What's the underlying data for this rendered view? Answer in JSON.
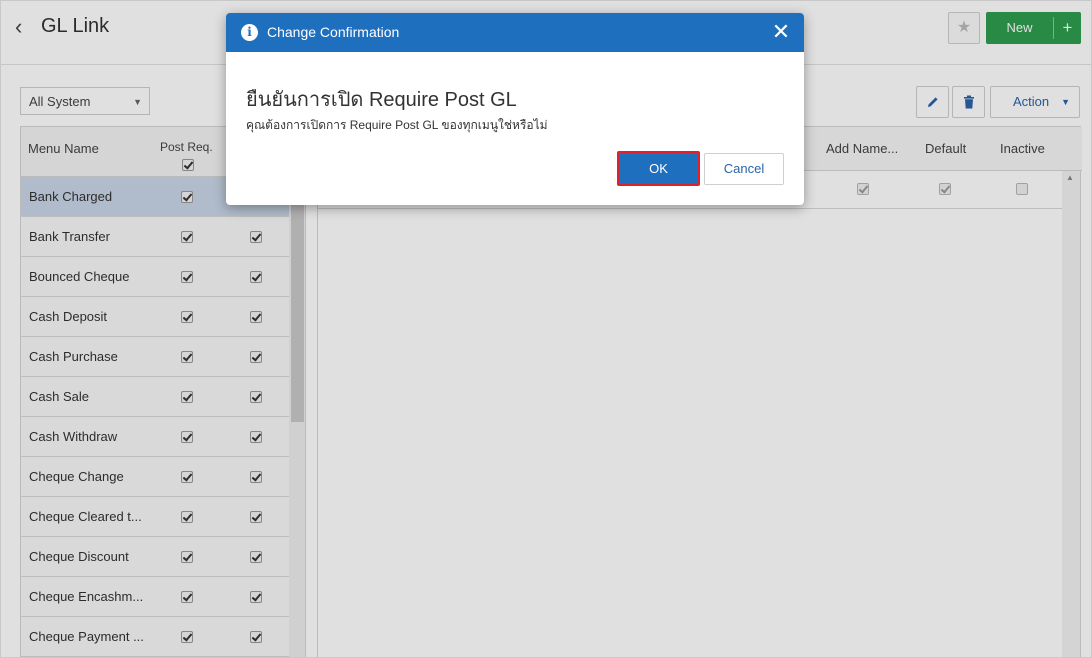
{
  "header": {
    "back_icon": "chevron-left-icon",
    "title": "GL Link",
    "favorite_icon": "star-icon",
    "new_label": "New",
    "new_plus": "+"
  },
  "toolbar": {
    "system_select": "All System",
    "edit_icon": "pencil-icon",
    "delete_icon": "trash-icon",
    "action_label": "Action"
  },
  "left_table": {
    "col_menu_name": "Menu Name",
    "col_post_req": "Post Req.",
    "header_post_req_checked": true,
    "rows": [
      {
        "name": "Bank Charged",
        "c1": true,
        "c2": true,
        "selected": true
      },
      {
        "name": "Bank Transfer",
        "c1": true,
        "c2": true
      },
      {
        "name": "Bounced Cheque",
        "c1": true,
        "c2": true
      },
      {
        "name": "Cash Deposit",
        "c1": true,
        "c2": true
      },
      {
        "name": "Cash Purchase",
        "c1": true,
        "c2": true
      },
      {
        "name": "Cash Sale",
        "c1": true,
        "c2": true
      },
      {
        "name": "Cash Withdraw",
        "c1": true,
        "c2": true
      },
      {
        "name": "Cheque Change",
        "c1": true,
        "c2": true
      },
      {
        "name": "Cheque Cleared t...",
        "c1": true,
        "c2": true
      },
      {
        "name": "Cheque Discount",
        "c1": true,
        "c2": true
      },
      {
        "name": "Cheque Encashm...",
        "c1": true,
        "c2": true
      },
      {
        "name": "Cheque Payment ...",
        "c1": true,
        "c2": true
      }
    ]
  },
  "right_table": {
    "col_add_name": "Add Name...",
    "col_default": "Default",
    "col_inactive": "Inactive",
    "row": {
      "add_name": true,
      "default": true,
      "inactive": false
    }
  },
  "dialog": {
    "info_icon": "info-icon",
    "title": "Change Confirmation",
    "close_icon": "close-icon",
    "heading": "ยืนยันการเปิด Require Post GL",
    "message": "คุณต้องการเปิดการ Require Post GL ของทุกเมนูใช่หรือไม่",
    "ok_label": "OK",
    "cancel_label": "Cancel",
    "ok_highlight_color": "#e0202a",
    "accent_color": "#1f6fbf"
  }
}
